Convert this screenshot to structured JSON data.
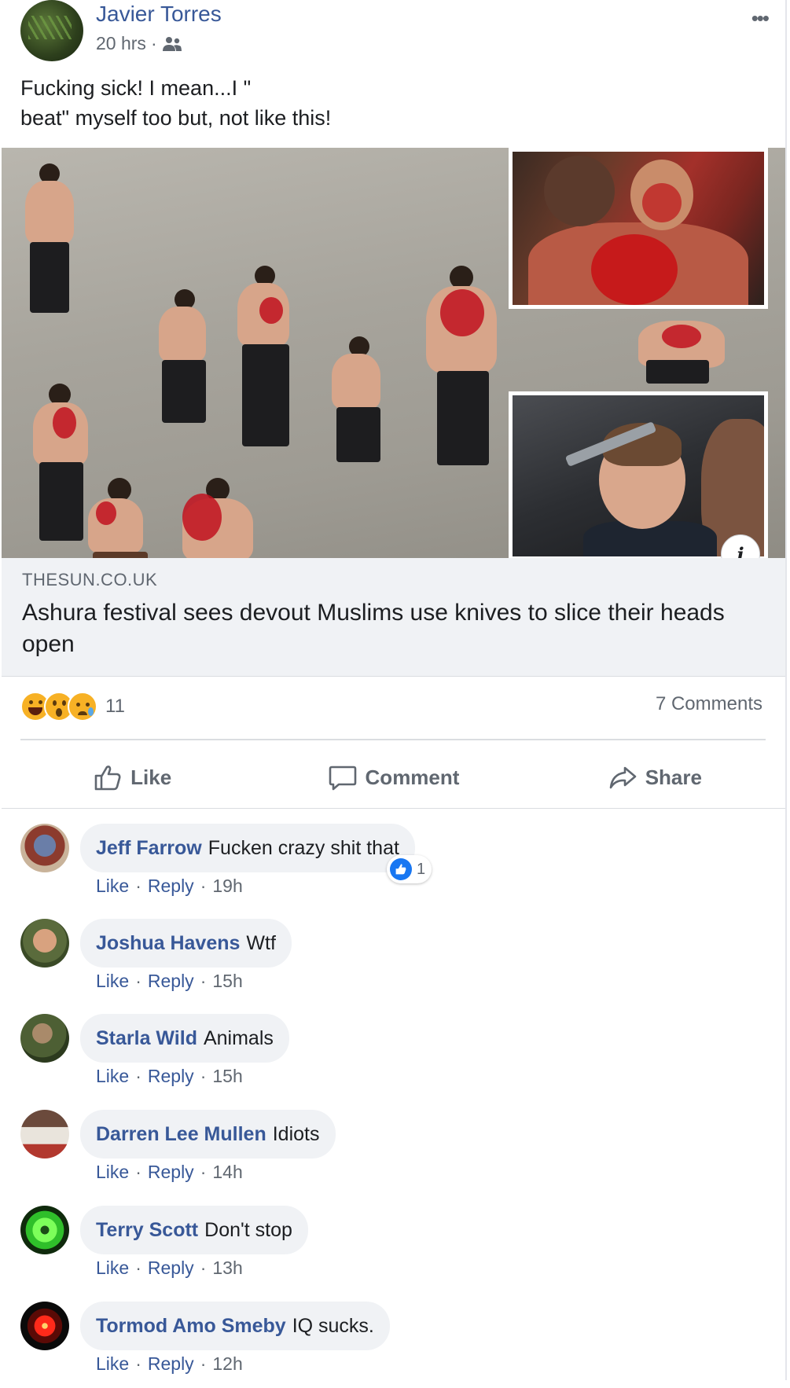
{
  "post": {
    "author": "Javier Torres",
    "time": "20 hrs",
    "separator": "·",
    "text_lines": [
      "Fucking sick! I mean...I \"",
      "beat\" myself too but, not like this!"
    ]
  },
  "link": {
    "domain": "THESUN.CO.UK",
    "headline": "Ashura festival sees devout Muslims use knives to slice their heads open"
  },
  "stats": {
    "reaction_count": "11",
    "comments": "7 Comments"
  },
  "actions": {
    "like": "Like",
    "comment": "Comment",
    "share": "Share"
  },
  "comments": [
    {
      "name": "Jeff Farrow",
      "text": "Fucken crazy shit that",
      "like": "Like",
      "reply": "Reply",
      "time": "19h",
      "reaction_count": "1"
    },
    {
      "name": "Joshua Havens",
      "text": "Wtf",
      "like": "Like",
      "reply": "Reply",
      "time": "15h"
    },
    {
      "name": "Starla Wild",
      "text": "Animals",
      "like": "Like",
      "reply": "Reply",
      "time": "15h"
    },
    {
      "name": "Darren Lee Mullen",
      "text": "Idiots",
      "like": "Like",
      "reply": "Reply",
      "time": "14h"
    },
    {
      "name": "Terry Scott",
      "text": "Don't stop",
      "like": "Like",
      "reply": "Reply",
      "time": "13h"
    },
    {
      "name": "Tormod Amo Smeby",
      "text": "IQ sucks.",
      "like": "Like",
      "reply": "Reply",
      "time": "12h"
    }
  ],
  "dot": "·",
  "info_label": "i",
  "colors": {
    "link_blue": "#385898",
    "fb_blue": "#1877f2",
    "muted": "#606770"
  }
}
